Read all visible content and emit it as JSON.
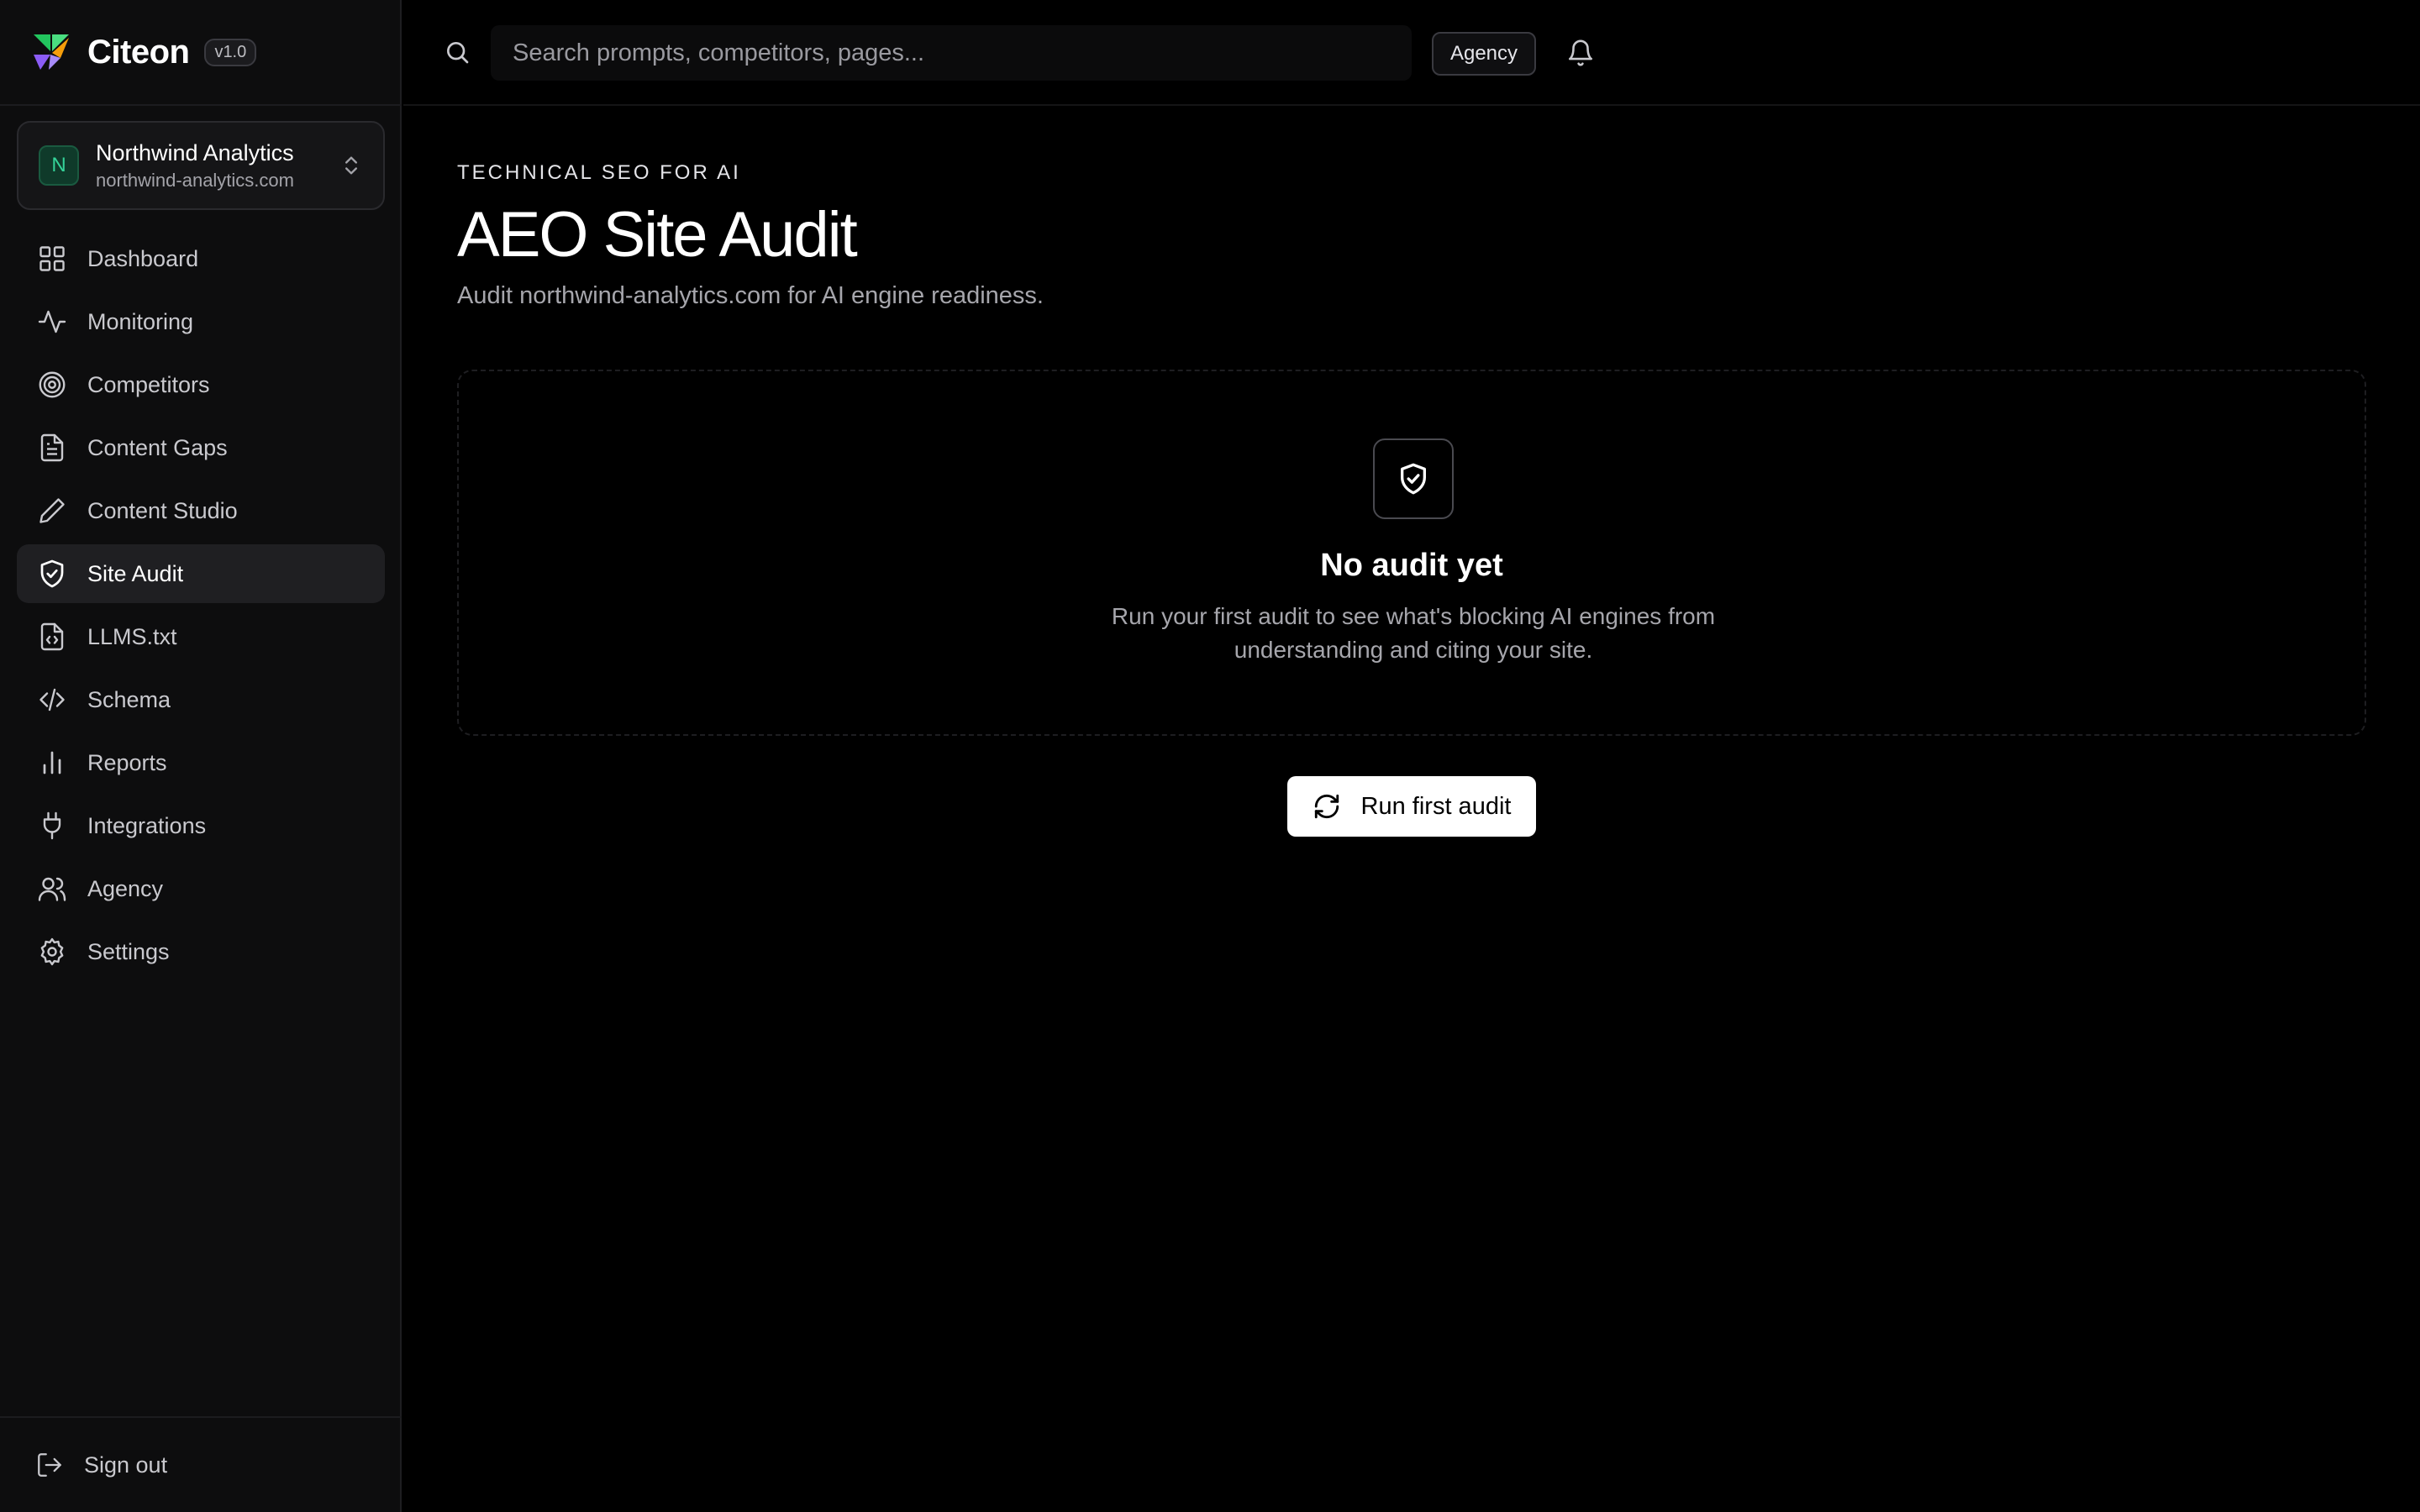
{
  "brand": {
    "name": "Citeon",
    "version": "v1.0"
  },
  "workspace": {
    "initial": "N",
    "name": "Northwind Analytics",
    "domain": "northwind-analytics.com"
  },
  "nav": {
    "items": [
      {
        "label": "Dashboard",
        "icon": "grid-icon"
      },
      {
        "label": "Monitoring",
        "icon": "activity-icon"
      },
      {
        "label": "Competitors",
        "icon": "target-icon"
      },
      {
        "label": "Content Gaps",
        "icon": "file-text-icon"
      },
      {
        "label": "Content Studio",
        "icon": "pen-icon"
      },
      {
        "label": "Site Audit",
        "icon": "shield-check-icon",
        "active": true
      },
      {
        "label": "LLMS.txt",
        "icon": "file-code-icon"
      },
      {
        "label": "Schema",
        "icon": "code-icon"
      },
      {
        "label": "Reports",
        "icon": "bar-chart-icon"
      },
      {
        "label": "Integrations",
        "icon": "plug-icon"
      },
      {
        "label": "Agency",
        "icon": "users-icon"
      },
      {
        "label": "Settings",
        "icon": "gear-icon"
      }
    ],
    "sign_out": "Sign out"
  },
  "topbar": {
    "search_placeholder": "Search prompts, competitors, pages...",
    "agency_label": "Agency"
  },
  "page": {
    "eyebrow": "TECHNICAL SEO FOR AI",
    "title": "AEO Site Audit",
    "subtitle": "Audit northwind-analytics.com for AI engine readiness."
  },
  "empty_state": {
    "title": "No audit yet",
    "description": "Run your first audit to see what's blocking AI engines from understanding and citing your site."
  },
  "actions": {
    "run_label": "Run first audit"
  },
  "colors": {
    "background": "#000000",
    "sidebar": "#0d0d0e",
    "accent_green": "#34d399",
    "logo_green": "#22c55e",
    "logo_amber": "#f59e0b",
    "logo_violet": "#8b5cf6"
  }
}
